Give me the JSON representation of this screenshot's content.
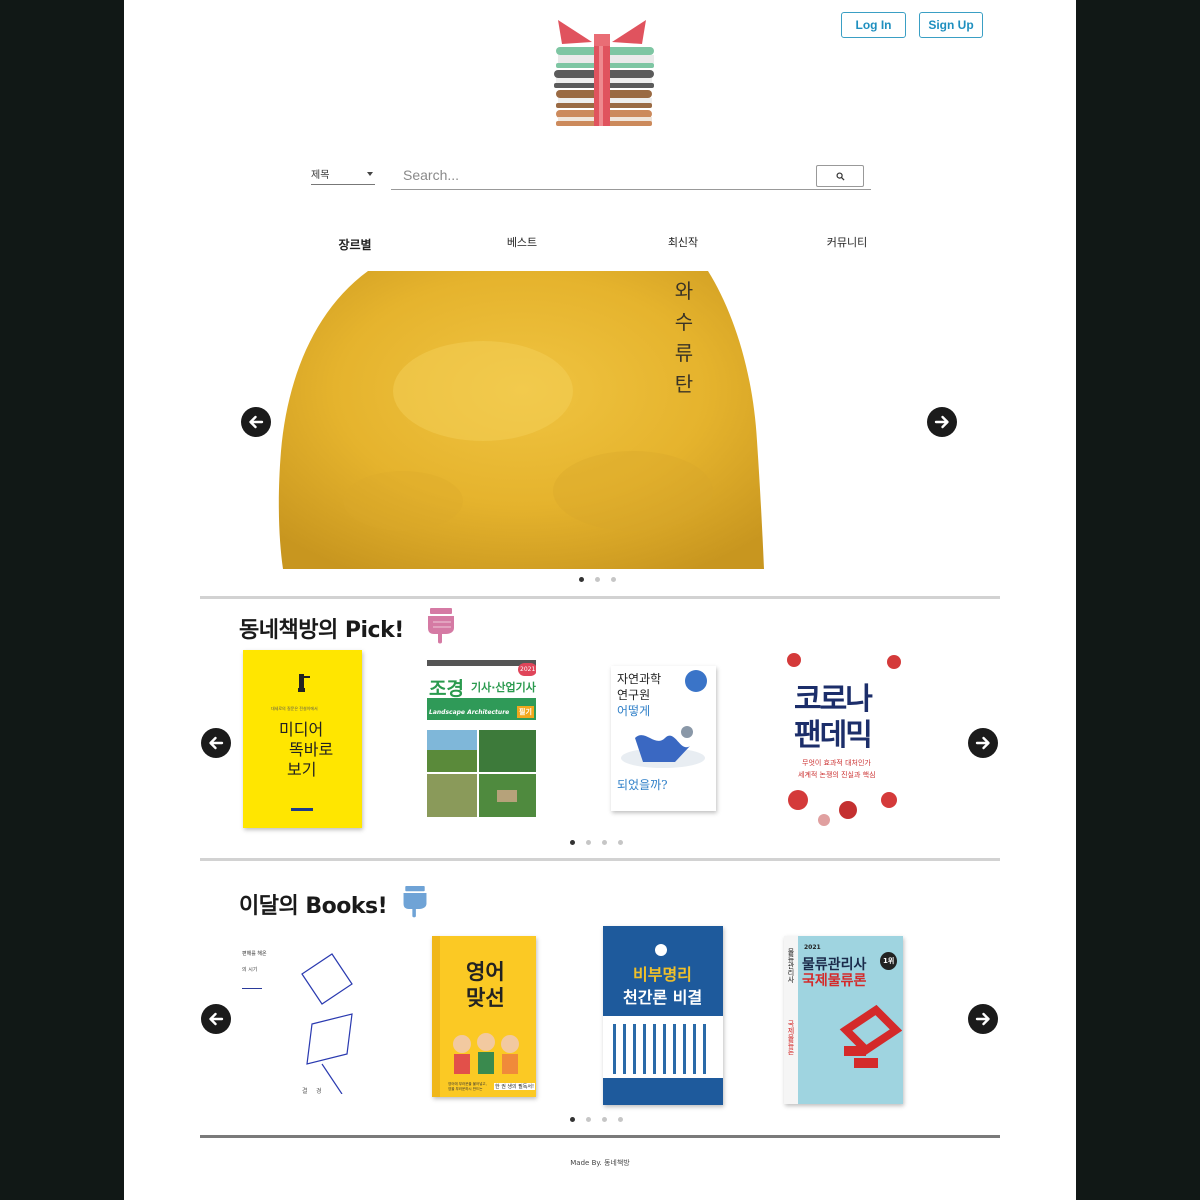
{
  "header": {
    "login_label": "Log In",
    "signup_label": "Sign Up"
  },
  "search": {
    "filter_value": "제목",
    "placeholder": "Search...",
    "button_icon": "search-icon"
  },
  "nav": {
    "items": [
      "장르별",
      "베스트",
      "최신작",
      "커뮤니티"
    ],
    "active_index": 0
  },
  "hero": {
    "cover_title_chars": [
      "와",
      "수",
      "류",
      "탄"
    ],
    "slide_count": 3,
    "active_slide": 0
  },
  "pick": {
    "title": "동네책방의  Pick!",
    "books": [
      {
        "lines": [
          "미디어",
          "똑바로",
          "보기"
        ],
        "small": "대세로의 질문은 전설이에서"
      },
      {
        "lines": [
          "조경",
          "기사·산업기사",
          "Landscape Architecture",
          "필기",
          "2021"
        ]
      },
      {
        "lines": [
          "자연과학",
          "연구원",
          "어떻게",
          "되었을까?"
        ]
      },
      {
        "lines": [
          "코로나",
          "팬데믹",
          "무엇이 효과적 대처인가",
          "세계적 논쟁의 진실과 핵심"
        ]
      }
    ],
    "dot_count": 4,
    "active_dot": 0
  },
  "monthly": {
    "title": "이달의 Books!",
    "books": [
      {
        "lines": [
          "편해를 해온",
          "의 시기",
          "결",
          "경"
        ]
      },
      {
        "lines": [
          "영어",
          "맞선",
          "한 권 생의 필독서!",
          "영어에 부러운을 불어넣고,",
          "영을 부러운하시 만드는"
        ]
      },
      {
        "lines": [
          "비부명리",
          "천간론 비결"
        ]
      },
      {
        "lines": [
          "2021",
          "물류관리사",
          "국제물류론",
          "물류관리사",
          "국제물류론",
          "1위"
        ]
      }
    ],
    "dot_count": 4,
    "active_dot": 0
  },
  "footer": {
    "text": "Made By. 동네책방"
  },
  "colors": {
    "accent": "#3a9fc4",
    "hero_yellow": "#e8b731",
    "dark_bg": "#111816"
  }
}
